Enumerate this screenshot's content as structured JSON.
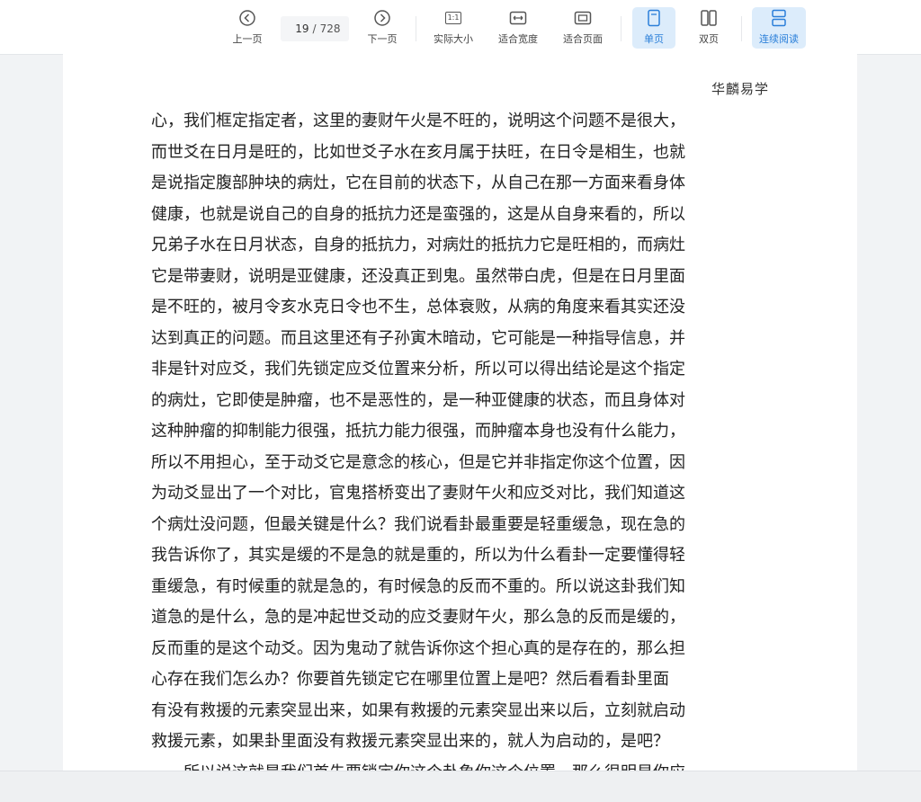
{
  "toolbar": {
    "prev_label": "上一页",
    "current_page": "19",
    "page_sep": "/",
    "total_pages": "728",
    "next_label": "下一页",
    "actual_size_label": "实际大小",
    "actual_size_icon_text": "1:1",
    "fit_width_label": "适合宽度",
    "fit_page_label": "适合页面",
    "single_page_label": "单页",
    "double_page_label": "双页",
    "continuous_label": "连续阅读",
    "accent_color": "#2b7fd9"
  },
  "document": {
    "header_mark": "华麟易学",
    "lines": [
      "心，我们框定指定者，这里的妻财午火是不旺的，说明这个问题不是很大，",
      "而世爻在日月是旺的，比如世爻子水在亥月属于扶旺，在日令是相生，也就",
      "是说指定腹部肿块的病灶，它在目前的状态下，从自己在那一方面来看身体",
      "健康，也就是说自己的自身的抵抗力还是蛮强的，这是从自身来看的，所以",
      "兄弟子水在日月状态，自身的抵抗力，对病灶的抵抗力它是旺相的，而病灶",
      "它是带妻财，说明是亚健康，还没真正到鬼。虽然带白虎，但是在日月里面",
      "是不旺的，被月令亥水克日令也不生，总体衰败，从病的角度来看其实还没",
      "达到真正的问题。而且这里还有子孙寅木暗动，它可能是一种指导信息，并",
      "非是针对应爻，我们先锁定应爻位置来分析，所以可以得出结论是这个指定",
      "的病灶，它即使是肿瘤，也不是恶性的，是一种亚健康的状态，而且身体对",
      "这种肿瘤的抑制能力很强，抵抗力能力很强，而肿瘤本身也没有什么能力，",
      "所以不用担心，至于动爻它是意念的核心，但是它并非指定你这个位置，因",
      "为动爻显出了一个对比，官鬼搭桥变出了妻财午火和应爻对比，我们知道这",
      "个病灶没问题，但最关键是什么？我们说看卦最重要是轻重缓急，现在急的",
      "我告诉你了，其实是缓的不是急的就是重的，所以为什么看卦一定要懂得轻",
      "重缓急，有时候重的就是急的，有时候急的反而不重的。所以说这卦我们知",
      "道急的是什么，急的是冲起世爻动的应爻妻财午火，那么急的反而是缓的，",
      "反而重的是这个动爻。因为鬼动了就告诉你这个担心真的是存在的，那么担",
      "心存在我们怎么办？你要首先锁定它在哪里位置上是吧？然后看看卦里面",
      "有没有救援的元素突显出来，如果有救援的元素突显出来以后，立刻就启动",
      "救援元素，如果卦里面没有救援元素突显出来的，就人为启动的，是吧？",
      "所以说这就是我们首先要锁定你这个卦象你这个位置，那么很明显你应"
    ]
  }
}
